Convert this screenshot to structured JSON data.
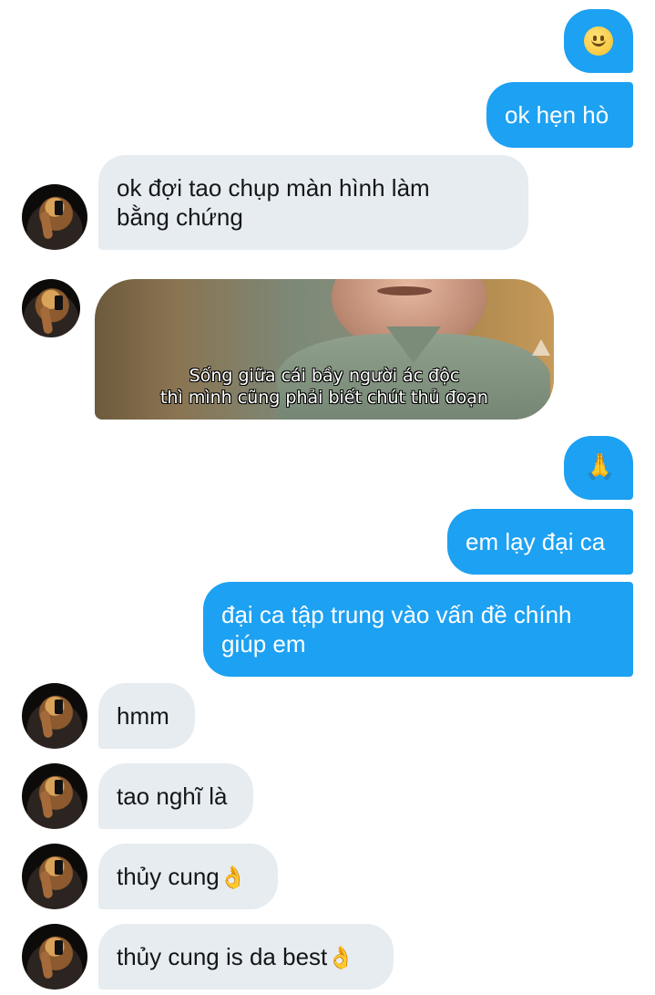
{
  "messages": [
    {
      "side": "out",
      "type": "emoji",
      "icon": "slightly-smiling-face"
    },
    {
      "side": "out",
      "type": "text",
      "text": "ok hẹn hò"
    },
    {
      "side": "in",
      "type": "text",
      "text": "ok đợi tao chụp màn hình làm\nbằng chứng"
    },
    {
      "side": "in",
      "type": "image",
      "icon": "video-still",
      "subtitle_line1": "Sống giữa cái bầy người ác độc",
      "subtitle_line2": "thì mình cũng phải biết chút thủ đoạn"
    },
    {
      "side": "out",
      "type": "emoji",
      "icon": "folded-hands"
    },
    {
      "side": "out",
      "type": "text",
      "text": "em lạy đại ca"
    },
    {
      "side": "out",
      "type": "text",
      "text": "đại ca tập trung vào vấn đề chính\ngiúp em"
    },
    {
      "side": "in",
      "type": "text",
      "text": "hmm"
    },
    {
      "side": "in",
      "type": "text",
      "text": "tao nghĩ là"
    },
    {
      "side": "in",
      "type": "text",
      "text": "thủy cung",
      "trailing_icon": "ok-hand"
    },
    {
      "side": "in",
      "type": "text",
      "text": "thủy cung is da best",
      "trailing_icon": "ok-hand"
    }
  ],
  "colors": {
    "outgoing_bubble": "#1da1f2",
    "incoming_bubble": "#e6ecf0",
    "background": "#ffffff"
  }
}
